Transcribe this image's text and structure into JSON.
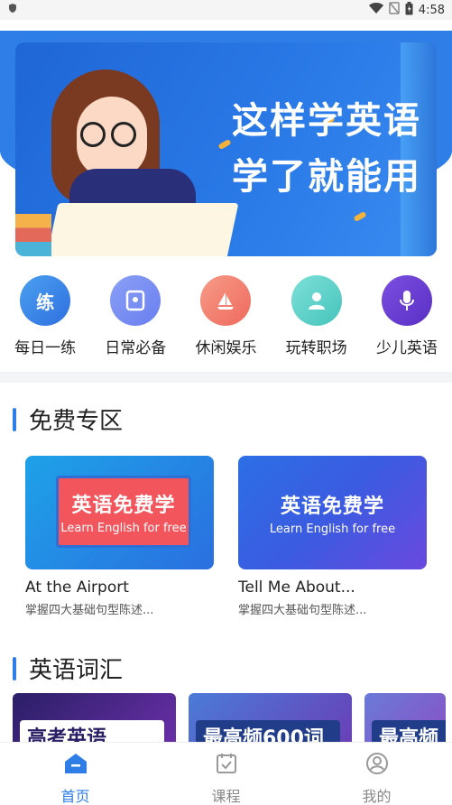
{
  "status_bar": {
    "time": "4:58"
  },
  "banner": {
    "title_line1": "这样学英语",
    "title_line2": "学了就能用"
  },
  "categories": [
    {
      "label": "每日一练",
      "icon_text": "练",
      "icon": "practice-icon",
      "color": "#3f86e8"
    },
    {
      "label": "日常必备",
      "icon_text": "",
      "icon": "book-mark-icon",
      "color": "#7b8ff0"
    },
    {
      "label": "休闲娱乐",
      "icon_text": "",
      "icon": "sailboat-icon",
      "color": "#f07a6a"
    },
    {
      "label": "玩转职场",
      "icon_text": "",
      "icon": "person-icon",
      "color": "#5fd0c8"
    },
    {
      "label": "少儿英语",
      "icon_text": "",
      "icon": "microphone-icon",
      "color": "#6a3fd0"
    }
  ],
  "sections": {
    "free": "免费专区",
    "vocab": "英语词汇"
  },
  "free_cards": [
    {
      "thumb_cn": "英语免费学",
      "thumb_en": "Learn English for free",
      "name": "At the Airport",
      "desc": "掌握四大基础句型陈述..."
    },
    {
      "thumb_cn": "英语免费学",
      "thumb_en": "Learn English for free",
      "name": "Tell Me About...",
      "desc": "掌握四大基础句型陈述..."
    }
  ],
  "vocab_cards": [
    {
      "text": "高考英语"
    },
    {
      "text": "最高频600词"
    },
    {
      "text": "最高频"
    }
  ],
  "bottom_nav": [
    {
      "label": "首页",
      "icon": "home-icon",
      "active": true
    },
    {
      "label": "课程",
      "icon": "calendar-check-icon",
      "active": false
    },
    {
      "label": "我的",
      "icon": "user-circle-icon",
      "active": false
    }
  ],
  "colors": {
    "accent": "#2f7de6"
  }
}
